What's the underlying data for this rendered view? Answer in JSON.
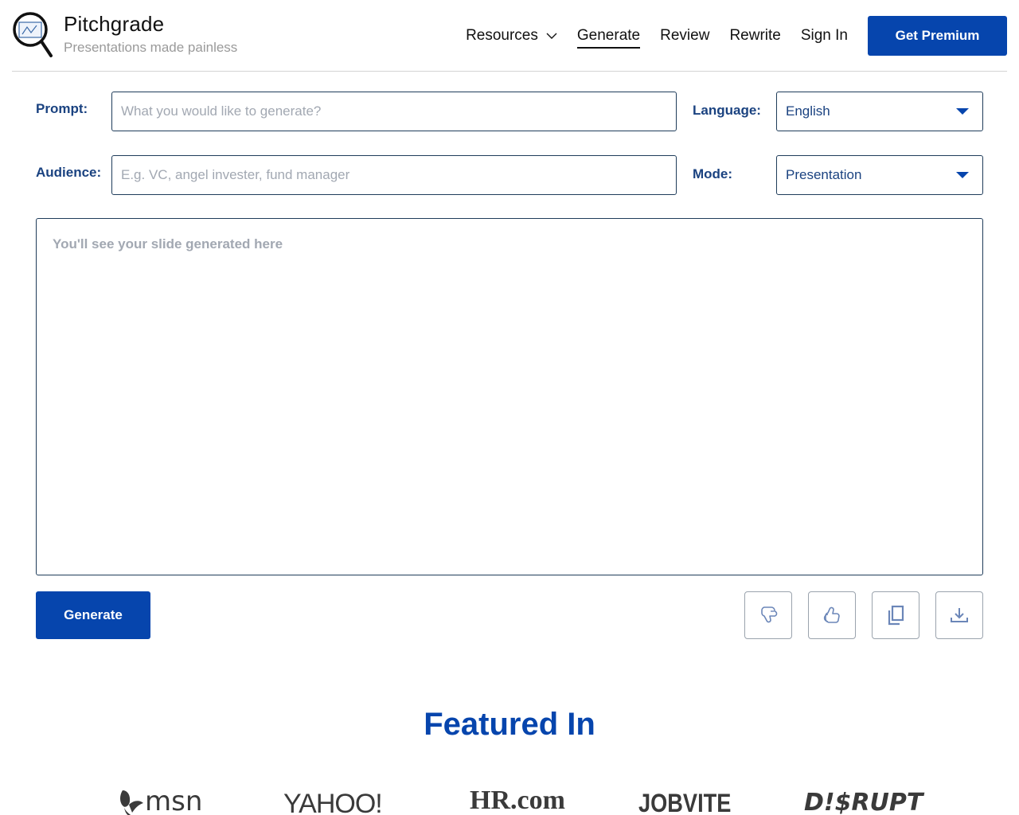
{
  "header": {
    "brand_name": "Pitchgrade",
    "tagline": "Presentations made painless",
    "logo_icon": "magnifier-chart-icon",
    "nav": [
      {
        "label": "Resources",
        "has_dropdown": true,
        "active": false
      },
      {
        "label": "Generate",
        "active": true
      },
      {
        "label": "Review",
        "active": false
      },
      {
        "label": "Rewrite",
        "active": false
      },
      {
        "label": "Sign In",
        "active": false
      }
    ],
    "cta_label": "Get Premium"
  },
  "form": {
    "prompt": {
      "label": "Prompt:",
      "value": "",
      "placeholder": "What you would like to generate?"
    },
    "audience": {
      "label": "Audience:",
      "value": "",
      "placeholder": "E.g. VC, angel invester, fund manager"
    },
    "language": {
      "label": "Language:",
      "selected": "English"
    },
    "mode": {
      "label": "Mode:",
      "selected": "Presentation"
    }
  },
  "output": {
    "placeholder": "You'll see your slide generated here"
  },
  "actions": {
    "generate_label": "Generate",
    "icons": [
      "thumbs-down-icon",
      "thumbs-up-icon",
      "copy-icon",
      "download-icon"
    ]
  },
  "featured": {
    "title": "Featured In",
    "logos": [
      "msn",
      "YAHOO!",
      "HR.com",
      "JOBVITE",
      "D!$RUPT"
    ]
  },
  "colors": {
    "brand_blue": "#0645ad",
    "label_blue": "#1a4280",
    "placeholder_gray": "#a2a8b2"
  }
}
